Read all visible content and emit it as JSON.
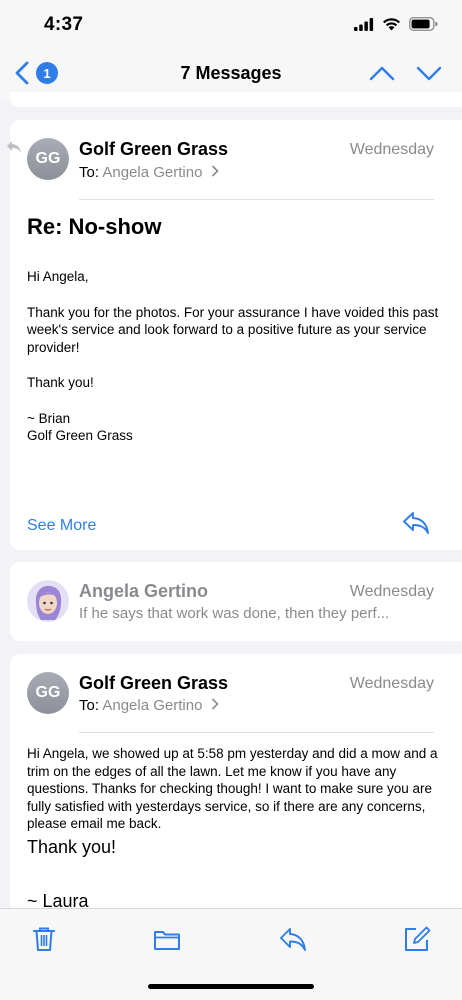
{
  "status_bar": {
    "time": "4:37"
  },
  "nav": {
    "badge_count": "1",
    "title": "7 Messages"
  },
  "messages": [
    {
      "avatar_initials": "GG",
      "sender": "Golf Green Grass",
      "date": "Wednesday",
      "to_prefix": "To:",
      "to_name": "Angela Gertino",
      "subject": "Re: No-show",
      "body": [
        "Hi Angela,",
        "Thank you for the photos. For your assurance I have voided this past week's service and look forward to a positive future as your service provider!",
        "Thank you!",
        "~ Brian",
        "Golf Green Grass"
      ],
      "see_more": "See More"
    },
    {
      "sender": "Angela Gertino",
      "date": "Wednesday",
      "preview": "If he says that work was done, then they perf..."
    },
    {
      "avatar_initials": "GG",
      "sender": "Golf Green Grass",
      "date": "Wednesday",
      "to_prefix": "To:",
      "to_name": "Angela Gertino",
      "body_paragraph": "Hi Angela, we showed up at 5:58 pm yesterday and did a mow and a trim on the edges of all the lawn. Let me know if you have any questions. Thanks for checking though! I want to make sure you are fully satisfied with yesterdays service, so if there are any concerns, please email me back.",
      "thank_you": "Thank you!",
      "signature": "~ Laura"
    }
  ],
  "colors": {
    "accent": "#2f7ee8",
    "secondary_text": "#8a8a8e",
    "background": "#f2f2f7"
  },
  "icons": {
    "status": [
      "signal-icon",
      "wifi-icon",
      "battery-icon"
    ],
    "nav": [
      "back-chevron-icon",
      "previous-message-icon",
      "next-message-icon"
    ],
    "toolbar": [
      "trash-icon",
      "folder-icon",
      "reply-icon",
      "compose-icon"
    ]
  }
}
